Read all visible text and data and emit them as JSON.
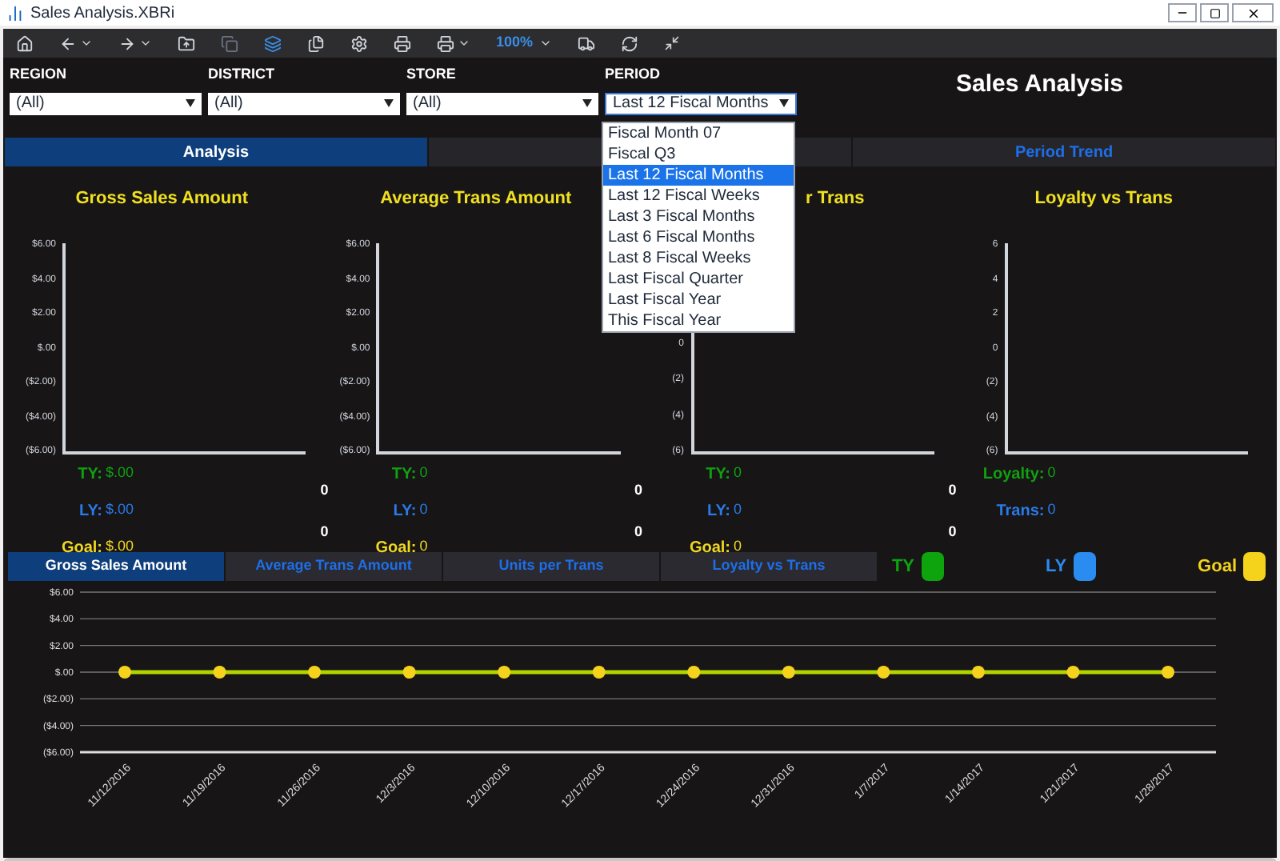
{
  "window": {
    "title": "Sales Analysis.XBRi"
  },
  "toolbar": {
    "zoom": "100%"
  },
  "filters": [
    {
      "label": "REGION",
      "value": "(All)"
    },
    {
      "label": "DISTRICT",
      "value": "(All)"
    },
    {
      "label": "STORE",
      "value": "(All)"
    },
    {
      "label": "PERIOD",
      "value": "Last 12 Fiscal Months",
      "expanded": true
    }
  ],
  "period_options": [
    {
      "label": "Fiscal Month 07",
      "selected": false
    },
    {
      "label": "Fiscal Q3",
      "selected": false
    },
    {
      "label": "Last 12 Fiscal Months",
      "selected": true
    },
    {
      "label": "Last 12 Fiscal Weeks",
      "selected": false
    },
    {
      "label": "Last 3 Fiscal Months",
      "selected": false
    },
    {
      "label": "Last 6 Fiscal Months",
      "selected": false
    },
    {
      "label": "Last 8 Fiscal Weeks",
      "selected": false
    },
    {
      "label": "Last Fiscal Quarter",
      "selected": false
    },
    {
      "label": "Last Fiscal Year",
      "selected": false
    },
    {
      "label": "This Fiscal Year",
      "selected": false
    }
  ],
  "page_title": "Sales Analysis",
  "view_tabs": [
    {
      "label": "Analysis",
      "selected": true
    },
    {
      "selected": false
    },
    {
      "label": "Period Trend",
      "selected": false
    }
  ],
  "panels": [
    {
      "title": "Gross Sales Amount",
      "yticks": [
        "$6.00",
        "$4.00",
        "$2.00",
        "$.00",
        "($2.00)",
        "($4.00)",
        "($6.00)"
      ],
      "stats": [
        {
          "kind": "ty",
          "label": "TY:",
          "value": "$.00"
        },
        {
          "kind": "ly",
          "label": "LY:",
          "value": "$.00"
        },
        {
          "kind": "goal",
          "label": "Goal:",
          "value": "$.00"
        }
      ],
      "extras": [
        "0",
        "0"
      ]
    },
    {
      "title": "Average Trans Amount",
      "yticks": [
        "$6.00",
        "$4.00",
        "$2.00",
        "$.00",
        "($2.00)",
        "($4.00)",
        "($6.00)"
      ],
      "stats": [
        {
          "kind": "ty",
          "label": "TY:",
          "value": "0"
        },
        {
          "kind": "ly",
          "label": "LY:",
          "value": "0"
        },
        {
          "kind": "goal",
          "label": "Goal:",
          "value": "0"
        }
      ],
      "extras": [
        "0",
        "0"
      ]
    },
    {
      "title": "r Trans",
      "yticks": [
        "0",
        "(2)",
        "(4)",
        "(6)"
      ],
      "stats": [
        {
          "kind": "ty",
          "label": "TY:",
          "value": "0"
        },
        {
          "kind": "ly",
          "label": "LY:",
          "value": "0"
        },
        {
          "kind": "goal",
          "label": "Goal:",
          "value": "0"
        }
      ],
      "extras": [
        "0",
        "0"
      ]
    },
    {
      "title": "Loyalty vs Trans",
      "yticks": [
        "6",
        "4",
        "2",
        "0",
        "(2)",
        "(4)",
        "(6)"
      ],
      "stats": [
        {
          "kind": "ty",
          "label": "Loyalty:",
          "value": "0"
        },
        {
          "kind": "ly",
          "label": "Trans:",
          "value": "0"
        }
      ]
    }
  ],
  "trend_tabs": [
    {
      "label": "Gross Sales Amount",
      "selected": true
    },
    {
      "label": "Average Trans Amount",
      "selected": false
    },
    {
      "label": "Units per Trans",
      "selected": false
    },
    {
      "label": "Loyalty vs Trans",
      "selected": false
    }
  ],
  "legend": [
    {
      "label": "TY",
      "color": "#0ea40e"
    },
    {
      "label": "LY",
      "color": "#2a8cf0"
    }
  ],
  "trend_chart": {
    "chart_data": {
      "type": "line",
      "grid": true,
      "categories": [
        "11/12/2016",
        "11/19/2016",
        "11/26/2016",
        "12/3/2016",
        "12/10/2016",
        "12/17/2016",
        "12/24/2016",
        "12/31/2016",
        "1/7/2017",
        "1/14/2017",
        "1/21/2017",
        "1/28/2017"
      ],
      "series": [
        {
          "name": "Goal",
          "color": "#f5d21c",
          "marker": "circle",
          "values": [
            0,
            0,
            0,
            0,
            0,
            0,
            0,
            0,
            0,
            0,
            0,
            0
          ]
        }
      ],
      "ylim": [
        -6,
        6
      ],
      "yticks": [
        {
          "value": 6,
          "label": "$6.00"
        },
        {
          "value": 4,
          "label": "$4.00"
        },
        {
          "value": 2,
          "label": "$2.00"
        },
        {
          "value": 0,
          "label": "$.00"
        },
        {
          "value": -2,
          "label": "($2.00)"
        },
        {
          "value": -4,
          "label": "($4.00)"
        },
        {
          "value": -6,
          "label": "($6.00)"
        }
      ]
    }
  }
}
